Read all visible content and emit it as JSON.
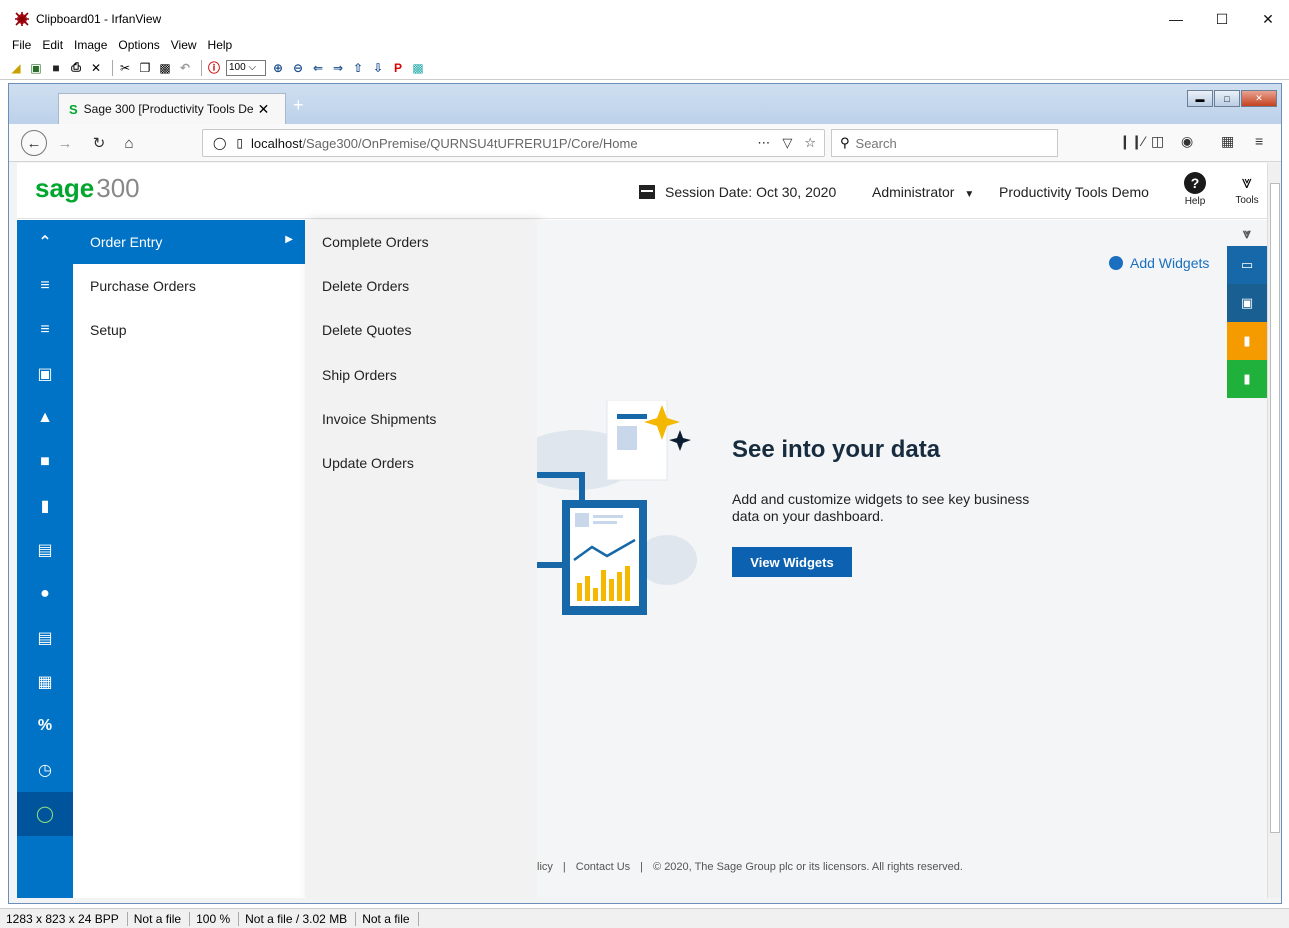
{
  "irfanview": {
    "title": "Clipboard01 - IrfanView",
    "menu": [
      "File",
      "Edit",
      "Image",
      "Options",
      "View",
      "Help"
    ],
    "zoom_value": "100",
    "status": [
      "1283 x 823 x 24 BPP",
      "Not a file",
      "100 %",
      "Not a file / 3.02 MB",
      "Not a file"
    ]
  },
  "browser": {
    "tab_title": "Sage 300 [Productivity Tools De",
    "url_host": "localhost",
    "url_path": "/Sage300/OnPremise/QURNSU4tUFRERU1P/Core/Home",
    "search_placeholder": "Search"
  },
  "sage": {
    "logo_brand": "sage",
    "logo_number": "300",
    "session_label": "Session Date:",
    "session_date": "Oct 30, 2020",
    "user": "Administrator",
    "company": "Productivity Tools Demo",
    "help_label": "Help",
    "tools_label": "Tools",
    "menu_l1": [
      {
        "label": "Order Entry",
        "selected": true
      },
      {
        "label": "Purchase Orders",
        "selected": false
      },
      {
        "label": "Setup",
        "selected": false
      }
    ],
    "menu_l2": [
      "Complete Orders",
      "Delete Orders",
      "Delete Quotes",
      "Ship Orders",
      "Invoice Shipments",
      "Update Orders"
    ],
    "add_widgets": "Add Widgets",
    "hero_title": "See into your data",
    "hero_desc": "Add and customize widgets to see key business data on your dashboard.",
    "view_widgets": "View Widgets",
    "footer": [
      "licy",
      "|",
      "Contact Us",
      "|",
      "© 2020, The Sage Group plc or its licensors. All rights reserved."
    ]
  },
  "colors": {
    "sage_green": "#00a62e",
    "sidebar_blue": "#0073c6",
    "button_blue": "#0c62b0",
    "rail_orange": "#f59b00",
    "rail_green": "#20b03c",
    "rail_teal": "#1668a8"
  },
  "icons": {
    "sidebar": [
      "home-icon",
      "receivables-icon",
      "payables-icon",
      "lock-icon",
      "bank-icon",
      "briefcase-icon",
      "folder-icon",
      "stack-icon",
      "people-icon",
      "ledger-icon",
      "grid-icon",
      "percent-icon",
      "clock-icon",
      "sage-globe-icon"
    ]
  }
}
